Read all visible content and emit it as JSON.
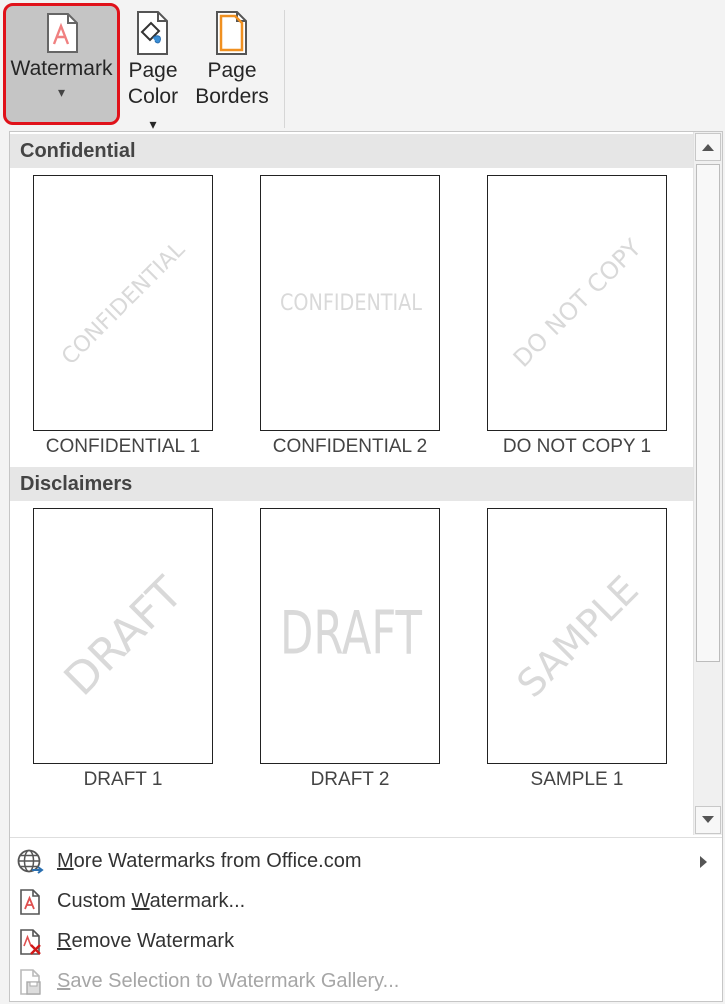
{
  "ribbon": {
    "watermark": {
      "label": "Watermark",
      "arrow": "▾"
    },
    "page_color": {
      "label_line1": "Page",
      "label_line2": "Color",
      "arrow": "▾"
    },
    "page_borders": {
      "label_line1": "Page",
      "label_line2": "Borders"
    }
  },
  "gallery": {
    "sections": [
      {
        "title": "Confidential",
        "items": [
          {
            "caption": "CONFIDENTIAL 1",
            "watermark": "CONFIDENTIAL",
            "style": "diagonal"
          },
          {
            "caption": "CONFIDENTIAL 2",
            "watermark": "CONFIDENTIAL",
            "style": "horizontal"
          },
          {
            "caption": "DO NOT COPY 1",
            "watermark": "DO NOT COPY",
            "style": "diagonal"
          }
        ]
      },
      {
        "title": "Disclaimers",
        "items": [
          {
            "caption": "DRAFT 1",
            "watermark": "DRAFT",
            "style": "diagonal"
          },
          {
            "caption": "DRAFT 2",
            "watermark": "DRAFT",
            "style": "horizontal"
          },
          {
            "caption": "SAMPLE 1",
            "watermark": "SAMPLE",
            "style": "diagonal"
          }
        ]
      }
    ]
  },
  "menu": {
    "more_watermarks": {
      "prefix": "M",
      "rest": "ore Watermarks from Office.com",
      "icon": "globe-icon"
    },
    "custom_watermark": {
      "prefix": "Custom ",
      "accel": "W",
      "rest": "atermark...",
      "icon": "watermark-doc-icon"
    },
    "remove_watermark": {
      "accel": "R",
      "rest": "emove Watermark",
      "icon": "remove-watermark-icon"
    },
    "save_selection": {
      "accel": "S",
      "rest": "ave Selection to Watermark Gallery...",
      "icon": "save-gallery-icon"
    }
  },
  "colors": {
    "highlight_border": "#e0121a",
    "watermark_text": "#d9d9d9"
  }
}
